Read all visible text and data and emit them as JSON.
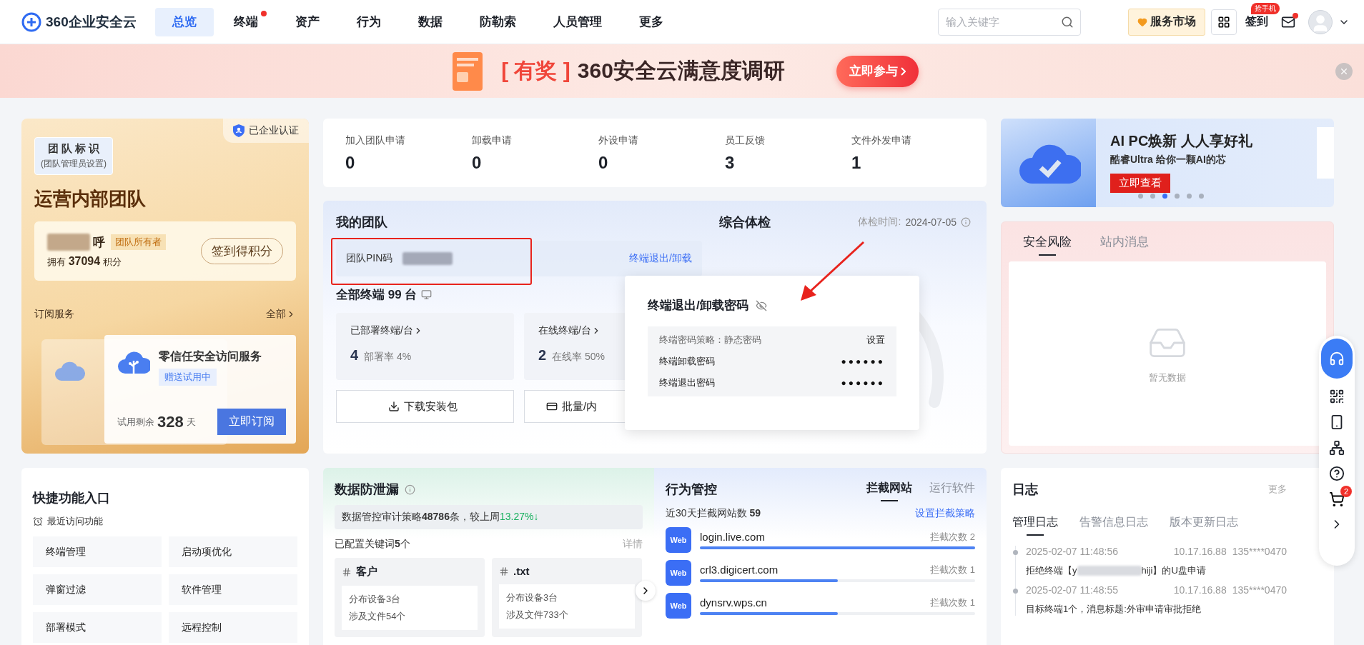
{
  "header": {
    "logo": "360企业安全云",
    "nav": [
      {
        "label": "总览",
        "selected": true,
        "dot": false
      },
      {
        "label": "终端",
        "selected": false,
        "dot": true
      },
      {
        "label": "资产",
        "selected": false,
        "dot": false
      },
      {
        "label": "行为",
        "selected": false,
        "dot": false
      },
      {
        "label": "数据",
        "selected": false,
        "dot": false
      },
      {
        "label": "防勒索",
        "selected": false,
        "dot": false
      },
      {
        "label": "人员管理",
        "selected": false,
        "dot": false
      },
      {
        "label": "更多",
        "selected": false,
        "dot": false
      }
    ],
    "search": {
      "placeholder": "输入关键字"
    },
    "market_button": "服务市场",
    "checkin": {
      "label": "签到",
      "badge": "抢手机"
    },
    "mail_unread": true
  },
  "banner": {
    "tag": "[ 有奖 ]",
    "title": "360安全云满意度调研",
    "button": "立即参与"
  },
  "team_card": {
    "verified": "已企业认证",
    "badge_title": "团 队 标 识",
    "badge_note": "(团队管理员设置)",
    "team_name": "运营内部团队",
    "user_name": "呼",
    "role": "团队所有者",
    "points": "拥有 **37094** 积分",
    "checkin_button": "签到得积分",
    "subscriptions_title": "订阅服务",
    "all_link": "全部",
    "service": {
      "name": "零信任安全访问服务",
      "tag": "赠送试用中",
      "remaining_label": "试用剩余",
      "remaining_days": "328",
      "remaining_unit": "天",
      "button": "立即订阅"
    }
  },
  "requests": [
    {
      "label": "加入团队申请",
      "value": "0"
    },
    {
      "label": "卸载申请",
      "value": "0"
    },
    {
      "label": "外设申请",
      "value": "0"
    },
    {
      "label": "员工反馈",
      "value": "3"
    },
    {
      "label": "文件外发申请",
      "value": "1"
    }
  ],
  "my_team": {
    "title": "我的团队",
    "pin_label": "团队PIN码",
    "exit_link": "终端退出/卸载",
    "total": "全部终端 99 台",
    "stats": [
      {
        "label": "已部署终端/台",
        "value": "4",
        "rate": "部署率 4%"
      },
      {
        "label": "在线终端/台",
        "value": "2",
        "rate": "在线率 50%"
      }
    ],
    "buttons": [
      {
        "label": "下载安装包",
        "kind": "download"
      },
      {
        "label": "批量/内",
        "kind": "batch"
      }
    ]
  },
  "checkup": {
    "title": "综合体检",
    "time_label": "体检时间:",
    "time": "2024-07-05"
  },
  "password_popup": {
    "title": "终端退出/卸载密码",
    "policy": "终端密码策略：静态密码",
    "settings": "设置",
    "rows": [
      {
        "label": "终端卸载密码",
        "value": "●●●●●●"
      },
      {
        "label": "终端退出密码",
        "value": "●●●●●●"
      }
    ]
  },
  "quick_access": {
    "title": "快捷功能入口",
    "recent": "最近访问功能",
    "items": [
      "终端管理",
      "启动项优化",
      "弹窗过滤",
      "软件管理",
      "部署模式",
      "远程控制"
    ]
  },
  "dlp": {
    "title": "数据防泄漏",
    "summary": "数据管控审计策略**48786**条，较上周",
    "change": "13.27%↓",
    "keywords": "已配置关键词**5**个",
    "details": "详情",
    "cards": [
      {
        "name": "客户",
        "devices": "分布设备3台",
        "files": "涉及文件54个"
      },
      {
        "name": ".txt",
        "devices": "分布设备3台",
        "files": "涉及文件733个"
      }
    ]
  },
  "behavior": {
    "title": "行为管控",
    "tabs": [
      {
        "label": "拦截网站",
        "selected": true
      },
      {
        "label": "运行软件",
        "selected": false
      }
    ],
    "summary": "近30天拦截网站数 **59**",
    "policy_link": "设置拦截策略",
    "sites": [
      {
        "icon": "Web",
        "domain": "login.live.com",
        "count": "拦截次数 2",
        "level": 1
      },
      {
        "icon": "Web",
        "domain": "crl3.digicert.com",
        "count": "拦截次数 1",
        "level": 0.5
      },
      {
        "icon": "Web",
        "domain": "dynsrv.wps.cn",
        "count": "拦截次数 1",
        "level": 0.5
      }
    ]
  },
  "ad": {
    "title": "AI PC焕新 人人享好礼",
    "subtitle": "酷睿Ultra 给你一颗AI的芯",
    "button": "立即查看",
    "dots": [
      {
        "selected": false
      },
      {
        "selected": false
      },
      {
        "selected": true
      },
      {
        "selected": false
      },
      {
        "selected": false
      },
      {
        "selected": false
      }
    ]
  },
  "risk": {
    "tabs": [
      {
        "label": "安全风险",
        "selected": true
      },
      {
        "label": "站内消息",
        "selected": false
      }
    ],
    "empty": "暂无数据"
  },
  "log": {
    "title": "日志",
    "more": "更多",
    "tabs": [
      {
        "label": "管理日志",
        "selected": true
      },
      {
        "label": "告警信息日志",
        "selected": false
      },
      {
        "label": "版本更新日志",
        "selected": false
      }
    ],
    "entries": [
      {
        "time": "2025-02-07 11:48:56",
        "ip": "10.17.16.88",
        "account": "135****0470",
        "message": "拒绝终端【y",
        "redacted": true,
        "message_end": "hiji】的U盘申请"
      },
      {
        "time": "2025-02-07 11:48:55",
        "ip": "10.17.16.88",
        "account": "135****0470",
        "message": "目标终端1个，消息标题:外审申请审批拒绝",
        "redacted": false
      }
    ]
  },
  "float_bar": {
    "cart_count": "2"
  }
}
